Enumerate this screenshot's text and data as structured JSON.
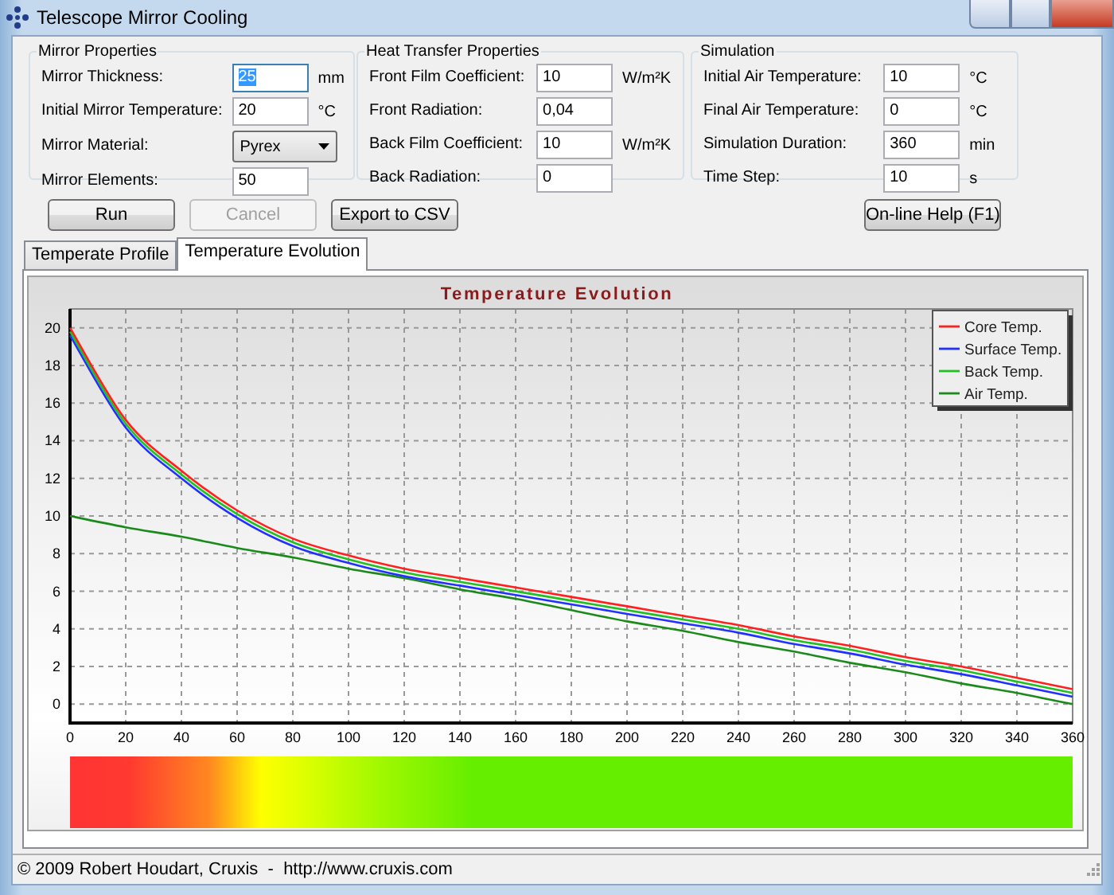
{
  "window": {
    "title": "Telescope Mirror Cooling"
  },
  "groups": [
    {
      "title": "Mirror Properties",
      "fields": [
        {
          "kind": "text",
          "label": "Mirror Thickness:",
          "value": "25",
          "unit": "mm",
          "focused": true
        },
        {
          "kind": "text",
          "label": "Initial Mirror Temperature:",
          "value": "20",
          "unit": "°C",
          "focused": false
        },
        {
          "kind": "dropdown",
          "label": "Mirror Material:",
          "value": "Pyrex"
        },
        {
          "kind": "text",
          "label": "Mirror Elements:",
          "value": "50",
          "focused": false
        }
      ]
    },
    {
      "title": "Heat Transfer Properties",
      "fields": [
        {
          "kind": "text",
          "label": "Front Film Coefficient:",
          "value": "10",
          "unit": "W/m²K",
          "focused": false
        },
        {
          "kind": "text",
          "label": "Front Radiation:",
          "value": "0,04",
          "focused": false
        },
        {
          "kind": "text",
          "label": "Back Film Coefficient:",
          "value": "10",
          "unit": "W/m²K",
          "focused": false
        },
        {
          "kind": "text",
          "label": "Back Radiation:",
          "value": "0",
          "focused": false
        }
      ]
    },
    {
      "title": "Simulation",
      "fields": [
        {
          "kind": "text",
          "label": "Initial Air Temperature:",
          "value": "10",
          "unit": "°C",
          "focused": false
        },
        {
          "kind": "text",
          "label": "Final Air Temperature:",
          "value": "0",
          "unit": "°C",
          "focused": false
        },
        {
          "kind": "text",
          "label": "Simulation Duration:",
          "value": "360",
          "unit": "min",
          "focused": false
        },
        {
          "kind": "text",
          "label": "Time Step:",
          "value": "10",
          "unit": "s",
          "focused": false
        }
      ]
    }
  ],
  "buttons": [
    {
      "label": "Run",
      "disabled": false
    },
    {
      "label": "Cancel",
      "disabled": true
    },
    {
      "label": "Export to CSV",
      "disabled": false
    },
    {
      "label": "On-line Help (F1)",
      "disabled": false
    }
  ],
  "tabs": [
    {
      "label": "Temperate Profile",
      "selected": false
    },
    {
      "label": "Temperature Evolution",
      "selected": true
    }
  ],
  "chart": {
    "chart_data": {
      "type": "line",
      "title": "Temperature Evolution",
      "x": [
        0,
        20,
        40,
        60,
        80,
        100,
        120,
        140,
        160,
        180,
        200,
        220,
        240,
        260,
        280,
        300,
        320,
        340,
        360
      ],
      "series": [
        {
          "name": "Core Temp.",
          "color": "#ff2020",
          "values": [
            20,
            15.1,
            12.4,
            10.3,
            8.8,
            7.9,
            7.2,
            6.7,
            6.2,
            5.7,
            5.2,
            4.7,
            4.2,
            3.6,
            3.1,
            2.5,
            2,
            1.4,
            0.8
          ]
        },
        {
          "name": "Surface Temp.",
          "color": "#2030ff",
          "values": [
            19.6,
            14.7,
            12,
            9.9,
            8.4,
            7.5,
            6.8,
            6.3,
            5.8,
            5.3,
            4.8,
            4.3,
            3.8,
            3.2,
            2.7,
            2.1,
            1.6,
            1,
            0.4
          ]
        },
        {
          "name": "Back Temp.",
          "color": "#20c020",
          "values": [
            19.8,
            14.9,
            12.2,
            10.1,
            8.6,
            7.7,
            7,
            6.5,
            6,
            5.5,
            5,
            4.5,
            4,
            3.4,
            2.9,
            2.3,
            1.8,
            1.2,
            0.6
          ]
        },
        {
          "name": "Air Temp.",
          "color": "#1a8a1a",
          "values": [
            10,
            9.4,
            8.9,
            8.3,
            7.8,
            7.2,
            6.7,
            6.1,
            5.6,
            5,
            4.4,
            3.9,
            3.3,
            2.8,
            2.2,
            1.7,
            1.1,
            0.6,
            0
          ]
        }
      ],
      "xlim": [
        0,
        360
      ],
      "ylim": [
        -1,
        21
      ],
      "grid": true,
      "legend": true,
      "xticks": [
        0,
        20,
        40,
        60,
        80,
        100,
        120,
        140,
        160,
        180,
        200,
        220,
        240,
        260,
        280,
        300,
        320,
        340,
        360
      ],
      "yticks": [
        0,
        2,
        4,
        6,
        8,
        10,
        12,
        14,
        16,
        18,
        20
      ]
    }
  },
  "status_bar": "© 2009 Robert Houdart, Cruxis  -  http://www.cruxis.com"
}
